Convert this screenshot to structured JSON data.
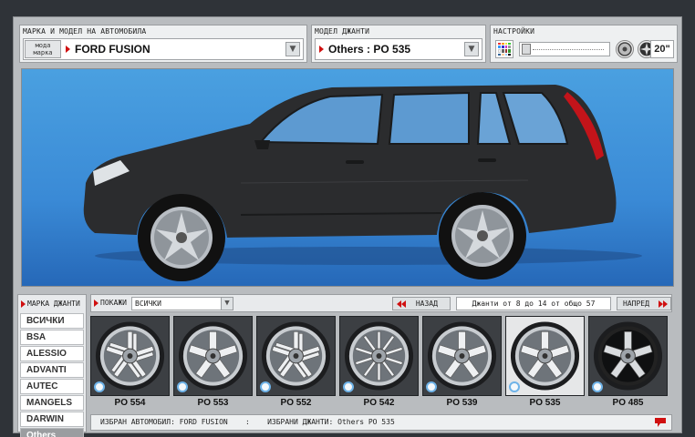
{
  "car_panel": {
    "label": "МАРКА И МОДЕЛ НА АВТОМОБИЛА",
    "mode_button": [
      "мода",
      "марка"
    ],
    "selected": "FORD FUSION"
  },
  "rim_panel": {
    "label": "МОДЕЛ ДЖАНТИ",
    "selected": "Others : PO 535"
  },
  "settings_panel": {
    "label": "НАСТРОЙКИ",
    "wheel_size": "20\""
  },
  "brands": {
    "title": "МАРКА ДЖАНТИ",
    "items": [
      "ВСИЧКИ",
      "BSA",
      "ALESSIO",
      "ADVANTI",
      "AUTEC",
      "MANGELS",
      "DARWIN",
      "Others"
    ],
    "active_index": 7
  },
  "toolbar": {
    "show_label": "ПОКАЖИ",
    "show_value": "ВСИЧКИ",
    "back_label": "НАЗАД",
    "next_label": "НАПРЕД",
    "counter_text": "Джанти от 8 до 14 от общо 57"
  },
  "wheels": [
    {
      "name": "PO 554",
      "style": "split5",
      "selected": false
    },
    {
      "name": "PO 553",
      "style": "star5",
      "selected": false
    },
    {
      "name": "PO 552",
      "style": "split5",
      "selected": false
    },
    {
      "name": "PO 542",
      "style": "multi10",
      "selected": false
    },
    {
      "name": "PO 539",
      "style": "star5",
      "selected": false
    },
    {
      "name": "PO 535",
      "style": "y5",
      "selected": true
    },
    {
      "name": "PO 485",
      "style": "black5",
      "selected": false
    }
  ],
  "status": {
    "car_label": "ИЗБРАН АВТОМОБИЛ:",
    "car_value": "FORD FUSION",
    "separator": ":",
    "rim_label": "ИЗБРАНИ ДЖАНТИ:",
    "rim_value": "Others PO 535"
  },
  "colors": {
    "accent_red": "#d01010",
    "sky": "#3a8ad6",
    "car_body": "#2b2c2e"
  }
}
